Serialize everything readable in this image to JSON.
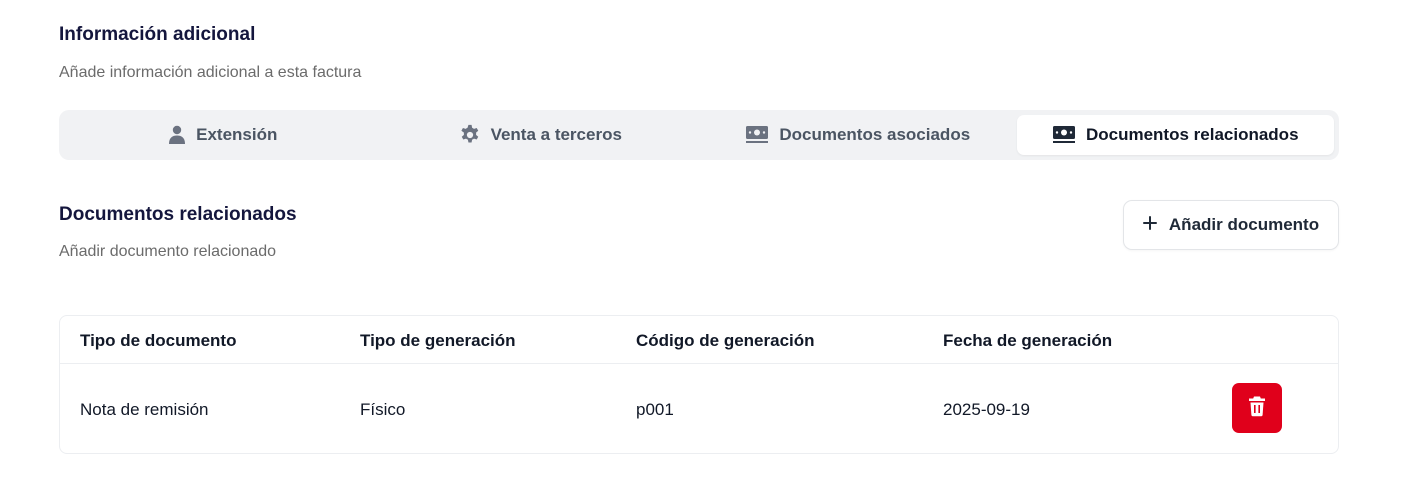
{
  "section": {
    "title": "Información adicional",
    "subtitle": "Añade información adicional a esta factura"
  },
  "tabs": [
    {
      "label": "Extensión",
      "icon": "user-icon",
      "active": false
    },
    {
      "label": "Venta a terceros",
      "icon": "gear-icon",
      "active": false
    },
    {
      "label": "Documentos asociados",
      "icon": "money-icon",
      "active": false
    },
    {
      "label": "Documentos relacionados",
      "icon": "money-icon",
      "active": true
    }
  ],
  "related": {
    "title": "Documentos relacionados",
    "subtitle": "Añadir documento relacionado",
    "add_button": "Añadir documento"
  },
  "table": {
    "headers": [
      "Tipo de documento",
      "Tipo de generación",
      "Código de generación",
      "Fecha de generación"
    ],
    "rows": [
      [
        "Nota de remisión",
        "Físico",
        "p001",
        "2025-09-19"
      ]
    ]
  },
  "colors": {
    "heading": "#14163d",
    "delete": "#e0001b",
    "tab_bg": "#f1f2f4"
  }
}
